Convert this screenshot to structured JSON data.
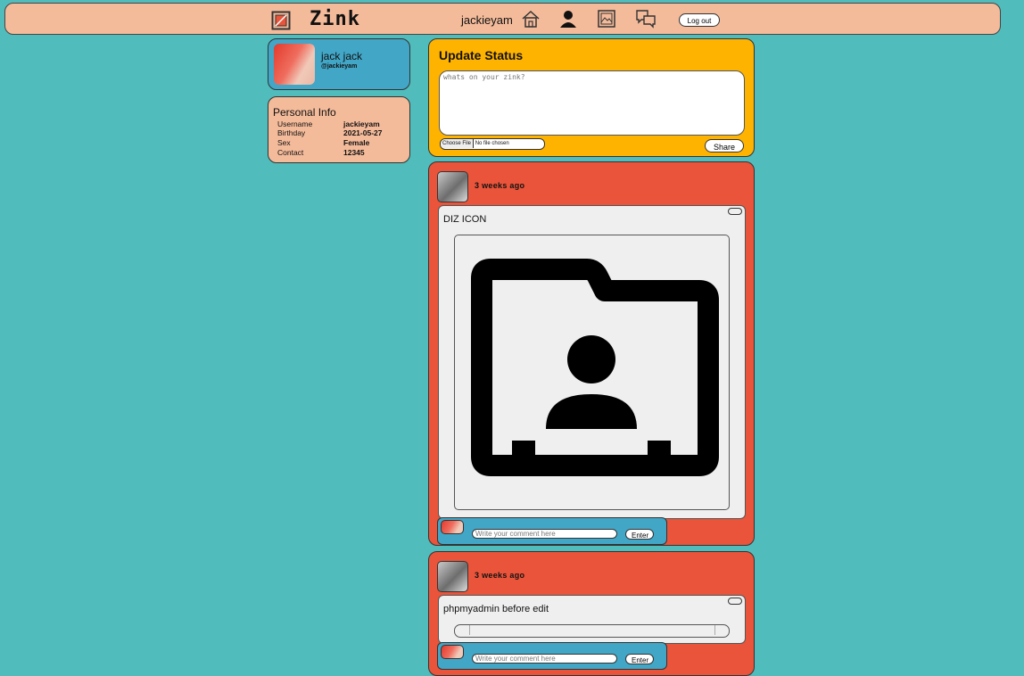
{
  "nav": {
    "brand": "Zink",
    "username": "jackieyam",
    "logout_label": "Log out",
    "icons": [
      "zink-logo-icon",
      "home-icon",
      "profile-icon",
      "gallery-icon",
      "chat-icon"
    ]
  },
  "profile": {
    "name": "jack jack",
    "handle": "@jackieyam"
  },
  "personal_info": {
    "title": "Personal Info",
    "rows": [
      {
        "label": "Username",
        "value": "jackieyam"
      },
      {
        "label": "Birthday",
        "value": "2021-05-27"
      },
      {
        "label": "Sex",
        "value": "Female"
      },
      {
        "label": "Contact",
        "value": "12345"
      }
    ]
  },
  "update_status": {
    "title": "Update Status",
    "placeholder": "whats on your zink?",
    "file_button": "Choose File",
    "file_status": "No file chosen",
    "share_label": "Share"
  },
  "posts": [
    {
      "time": "3 weeks ago",
      "text": "DIZ ICON",
      "image": "folder-contact-icon",
      "comment_placeholder": "Write your comment here",
      "enter_label": "Enter"
    },
    {
      "time": "3 weeks ago",
      "text": "phpmyadmin before edit",
      "image": "broken-image-icon",
      "comment_placeholder": "Write your comment here",
      "enter_label": "Enter"
    }
  ],
  "colors": {
    "background": "#50bcbb",
    "topbar": "#f4bb9b",
    "profile_card": "#42a6c7",
    "status_card": "#feb300",
    "post_card": "#e9543a"
  }
}
